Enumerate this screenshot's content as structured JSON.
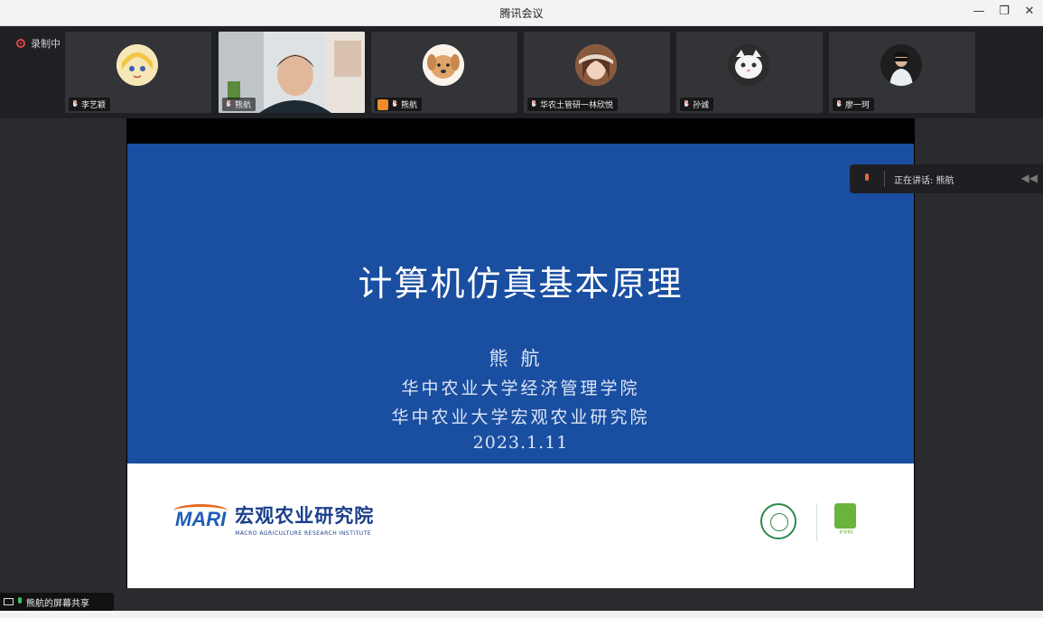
{
  "window": {
    "title": "腾讯会议",
    "controls": [
      "minimize",
      "restore",
      "close"
    ]
  },
  "recording": {
    "label": "录制中"
  },
  "participants": [
    {
      "name": "李艺颖",
      "avatar": "anime-girl",
      "mic": "muted"
    },
    {
      "name": "熊航",
      "avatar": "camera-video",
      "mic": "active"
    },
    {
      "name": "熊航",
      "avatar": "cartoon-dog",
      "mic": "muted",
      "host": true
    },
    {
      "name": "华农土管研一林欣悦",
      "avatar": "girl-photo",
      "mic": "muted"
    },
    {
      "name": "孙诚",
      "avatar": "white-cat",
      "mic": "muted"
    },
    {
      "name": "廖一珂",
      "avatar": "person-photo",
      "mic": "muted"
    }
  ],
  "speaking": {
    "label": "正在讲话: 熊航"
  },
  "slide": {
    "title": "计算机仿真基本原理",
    "author": "熊航",
    "affiliation_1": "华中农业大学经济管理学院",
    "affiliation_2": "华中农业大学宏观农业研究院",
    "date": "2023.1.11",
    "logo_text": "MARI",
    "institute_cn": "宏观农业研究院",
    "institute_en": "MACRO AGRICULTURE RESEARCH INSTITUTE",
    "partner_logo_text": "IFPRI"
  },
  "share_status": {
    "label": "熊航的屏幕共享"
  },
  "colors": {
    "slide_blue": "#1a4ea0",
    "background": "#2a2b2e",
    "record_red": "#e04848"
  }
}
